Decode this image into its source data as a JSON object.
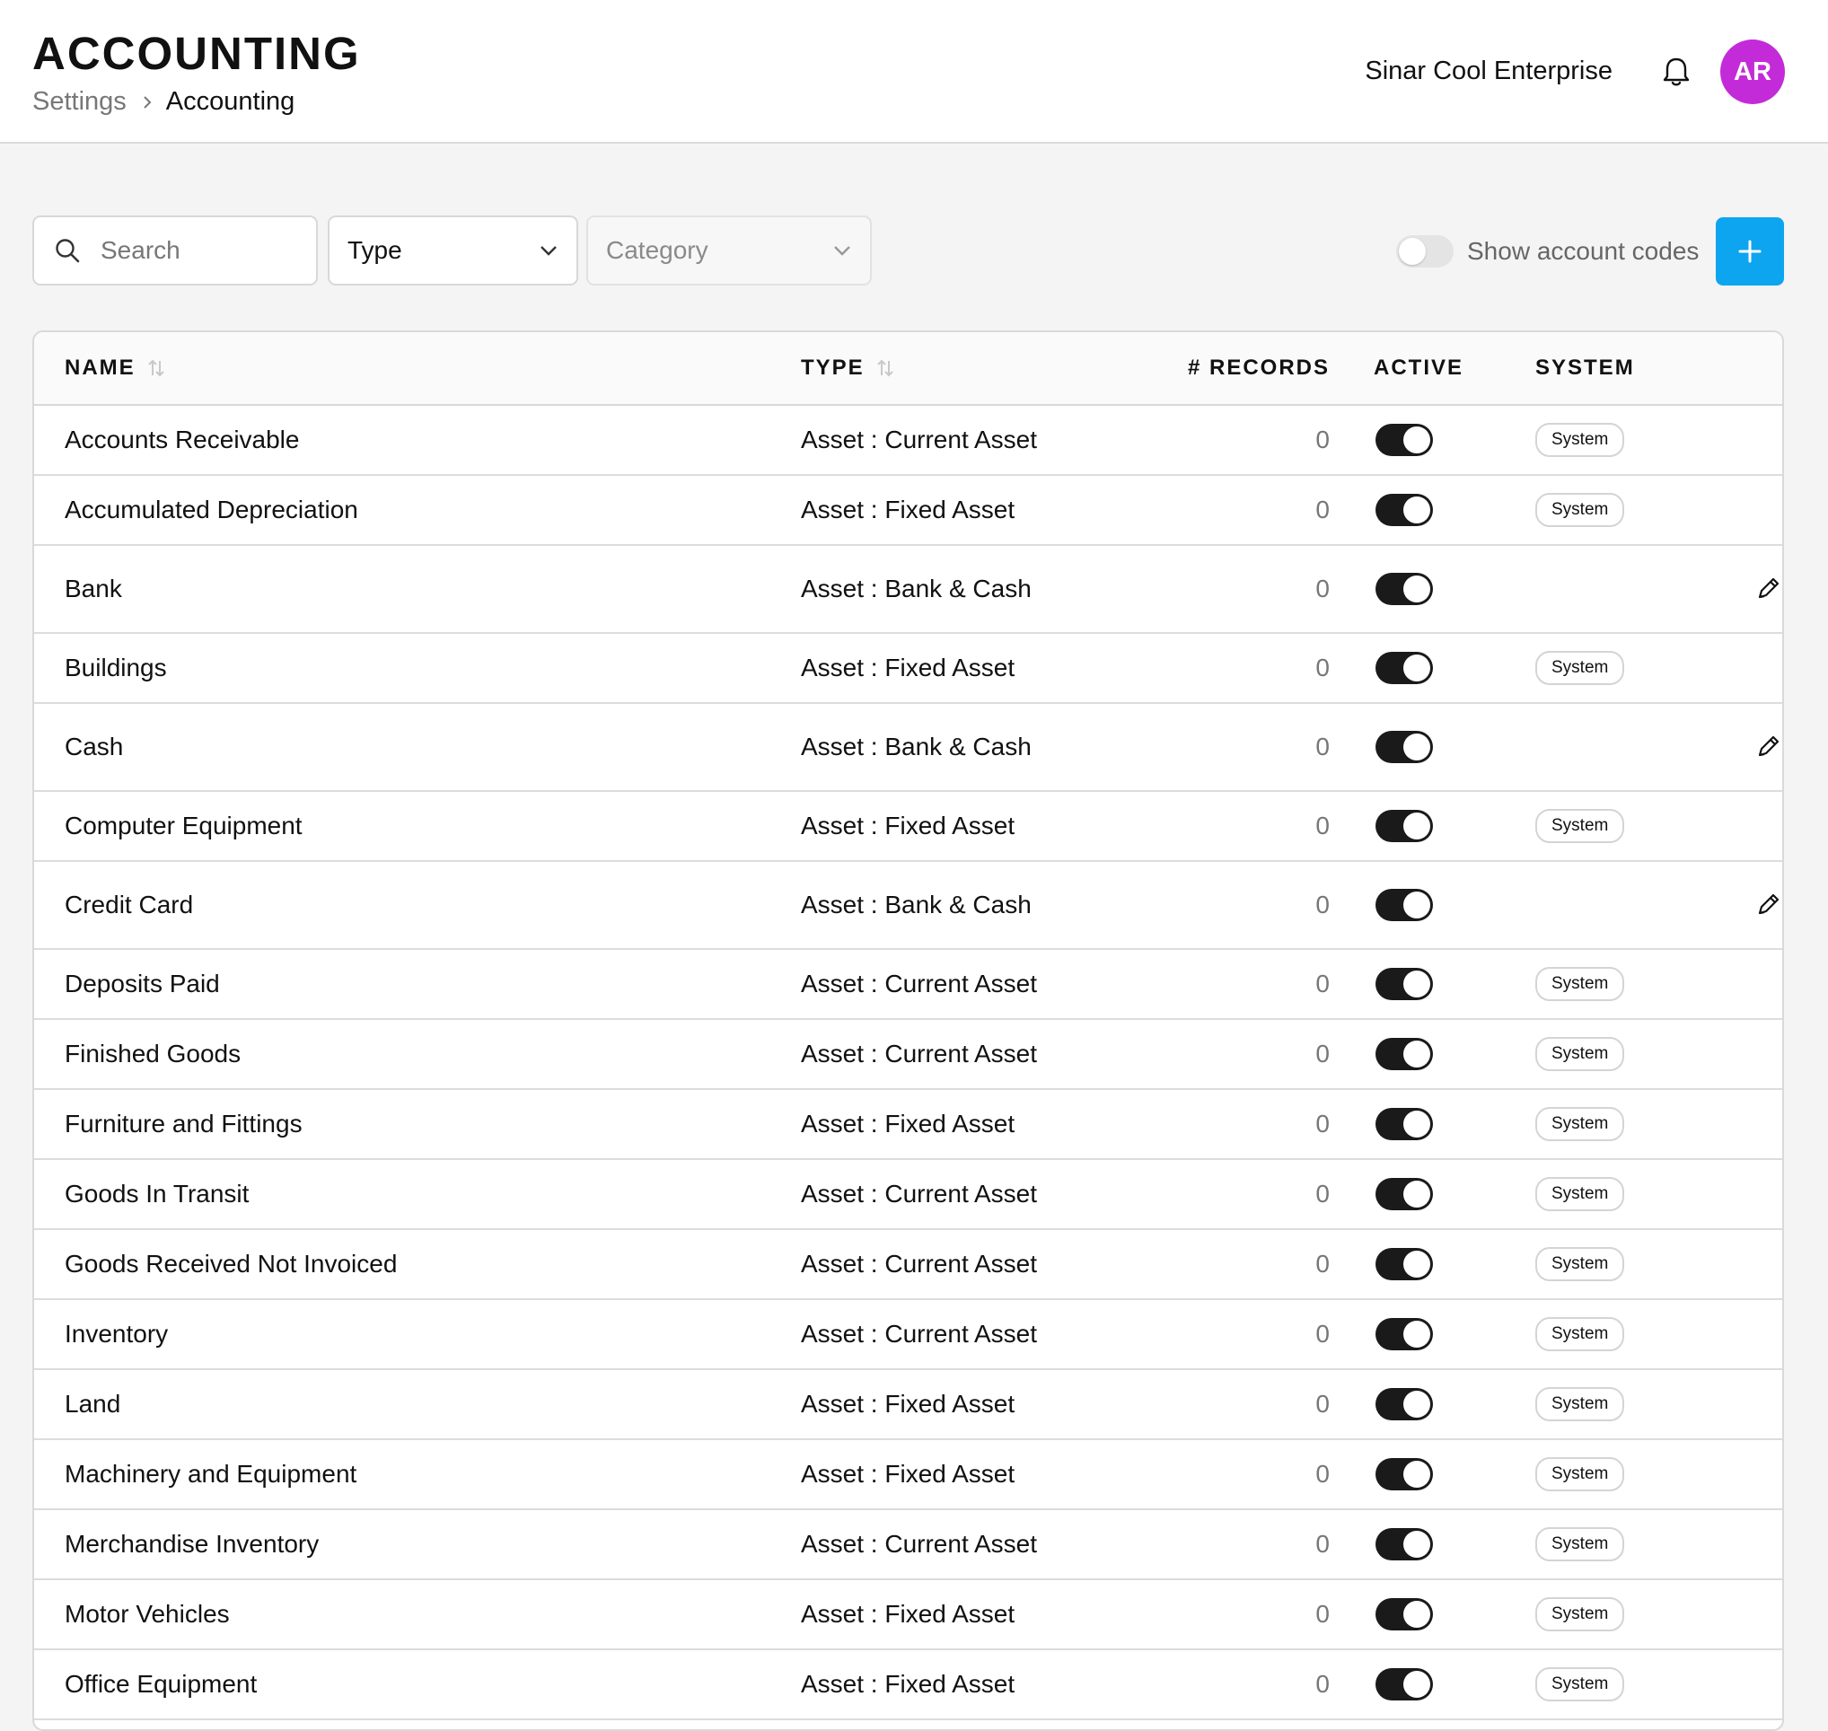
{
  "header": {
    "title": "ACCOUNTING",
    "breadcrumb": [
      "Settings",
      "Accounting"
    ],
    "company": "Sinar Cool Enterprise",
    "avatar_initials": "AR",
    "avatar_color": "#c42bd8"
  },
  "toolbar": {
    "search_placeholder": "Search",
    "type_label": "Type",
    "category_placeholder": "Category",
    "show_codes_label": "Show account codes",
    "show_codes_on": false,
    "add_button_color": "#0ea5f0"
  },
  "table": {
    "columns": [
      "NAME",
      "TYPE",
      "# RECORDS",
      "ACTIVE",
      "SYSTEM"
    ],
    "rows": [
      {
        "name": "Accounts Receivable",
        "type": "Asset : Current Asset",
        "records": "0",
        "active": true,
        "system": "System"
      },
      {
        "name": "Accumulated Depreciation",
        "type": "Asset : Fixed Asset",
        "records": "0",
        "active": true,
        "system": "System"
      },
      {
        "name": "Bank",
        "type": "Asset : Bank & Cash",
        "records": "0",
        "active": true,
        "system": ""
      },
      {
        "name": "Buildings",
        "type": "Asset : Fixed Asset",
        "records": "0",
        "active": true,
        "system": "System"
      },
      {
        "name": "Cash",
        "type": "Asset : Bank & Cash",
        "records": "0",
        "active": true,
        "system": ""
      },
      {
        "name": "Computer Equipment",
        "type": "Asset : Fixed Asset",
        "records": "0",
        "active": true,
        "system": "System"
      },
      {
        "name": "Credit Card",
        "type": "Asset : Bank & Cash",
        "records": "0",
        "active": true,
        "system": ""
      },
      {
        "name": "Deposits Paid",
        "type": "Asset : Current Asset",
        "records": "0",
        "active": true,
        "system": "System"
      },
      {
        "name": "Finished Goods",
        "type": "Asset : Current Asset",
        "records": "0",
        "active": true,
        "system": "System"
      },
      {
        "name": "Furniture and Fittings",
        "type": "Asset : Fixed Asset",
        "records": "0",
        "active": true,
        "system": "System"
      },
      {
        "name": "Goods In Transit",
        "type": "Asset : Current Asset",
        "records": "0",
        "active": true,
        "system": "System"
      },
      {
        "name": "Goods Received Not Invoiced",
        "type": "Asset : Current Asset",
        "records": "0",
        "active": true,
        "system": "System"
      },
      {
        "name": "Inventory",
        "type": "Asset : Current Asset",
        "records": "0",
        "active": true,
        "system": "System"
      },
      {
        "name": "Land",
        "type": "Asset : Fixed Asset",
        "records": "0",
        "active": true,
        "system": "System"
      },
      {
        "name": "Machinery and Equipment",
        "type": "Asset : Fixed Asset",
        "records": "0",
        "active": true,
        "system": "System"
      },
      {
        "name": "Merchandise Inventory",
        "type": "Asset : Current Asset",
        "records": "0",
        "active": true,
        "system": "System"
      },
      {
        "name": "Motor Vehicles",
        "type": "Asset : Fixed Asset",
        "records": "0",
        "active": true,
        "system": "System"
      },
      {
        "name": "Office Equipment",
        "type": "Asset : Fixed Asset",
        "records": "0",
        "active": true,
        "system": "System"
      }
    ]
  }
}
